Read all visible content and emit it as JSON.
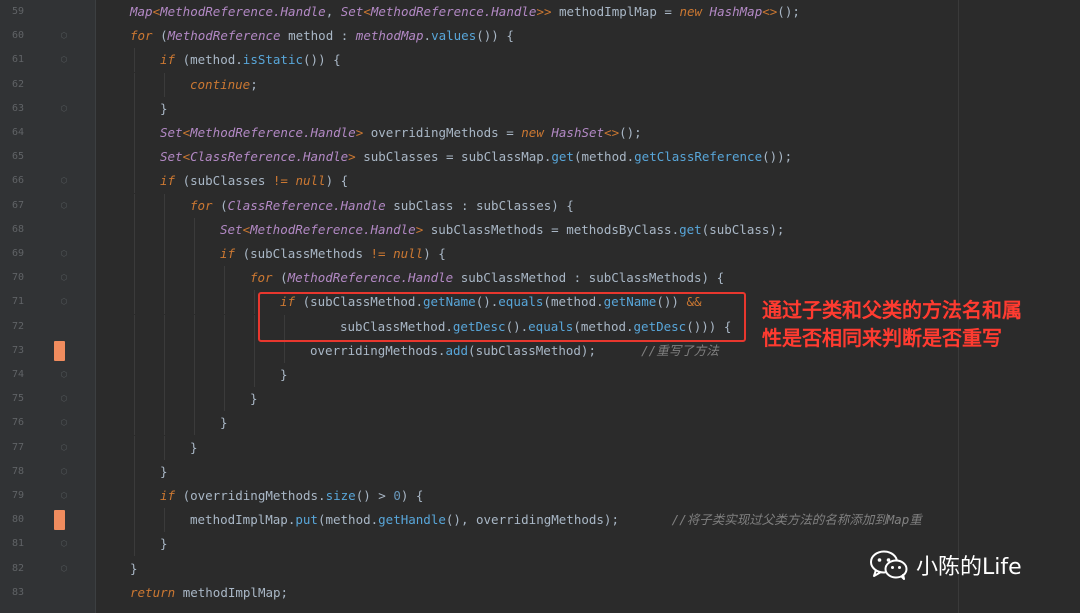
{
  "editor": {
    "lines": [
      {
        "num": "59",
        "indent": 0,
        "tokens": [
          [
            "tp",
            "Map"
          ],
          [
            "gen",
            "<"
          ],
          [
            "tp",
            "MethodReference.Handle"
          ],
          [
            "op",
            ", "
          ],
          [
            "tp",
            "Set"
          ],
          [
            "gen",
            "<"
          ],
          [
            "tp",
            "MethodReference.Handle"
          ],
          [
            "gen",
            ">>"
          ],
          [
            "op",
            " methodImplMap = "
          ],
          [
            "kw",
            "new "
          ],
          [
            "tp",
            "HashMap"
          ],
          [
            "gen",
            "<>"
          ],
          [
            "op",
            "();"
          ]
        ]
      },
      {
        "num": "60",
        "indent": 0,
        "fold": "open",
        "tokens": [
          [
            "kw",
            "for "
          ],
          [
            "op",
            "("
          ],
          [
            "tp",
            "MethodReference "
          ],
          [
            "op",
            "method : "
          ],
          [
            "tp",
            "methodMap"
          ],
          [
            "op",
            "."
          ],
          [
            "meth",
            "values"
          ],
          [
            "op",
            "()) {"
          ]
        ]
      },
      {
        "num": "61",
        "indent": 1,
        "fold": "open",
        "tokens": [
          [
            "kw",
            "if "
          ],
          [
            "op",
            "(method."
          ],
          [
            "meth",
            "isStatic"
          ],
          [
            "op",
            "()) {"
          ]
        ]
      },
      {
        "num": "62",
        "indent": 2,
        "tokens": [
          [
            "kw",
            "continue"
          ],
          [
            "op",
            ";"
          ]
        ]
      },
      {
        "num": "63",
        "indent": 1,
        "fold": "end",
        "tokens": [
          [
            "op",
            "}"
          ]
        ]
      },
      {
        "num": "64",
        "indent": 1,
        "tokens": [
          [
            "tp",
            "Set"
          ],
          [
            "gen",
            "<"
          ],
          [
            "tp",
            "MethodReference.Handle"
          ],
          [
            "gen",
            ">"
          ],
          [
            "op",
            " overridingMethods = "
          ],
          [
            "kw",
            "new "
          ],
          [
            "tp",
            "HashSet"
          ],
          [
            "gen",
            "<>"
          ],
          [
            "op",
            "();"
          ]
        ]
      },
      {
        "num": "65",
        "indent": 1,
        "tokens": [
          [
            "tp",
            "Set"
          ],
          [
            "gen",
            "<"
          ],
          [
            "tp",
            "ClassReference.Handle"
          ],
          [
            "gen",
            ">"
          ],
          [
            "op",
            " subClasses = subClassMap."
          ],
          [
            "meth",
            "get"
          ],
          [
            "op",
            "(method."
          ],
          [
            "meth",
            "getClassReference"
          ],
          [
            "op",
            "());"
          ]
        ]
      },
      {
        "num": "66",
        "indent": 1,
        "fold": "open",
        "tokens": [
          [
            "kw",
            "if "
          ],
          [
            "op",
            "(subClasses "
          ],
          [
            "gen",
            "!= "
          ],
          [
            "kw",
            "null"
          ],
          [
            "op",
            ") {"
          ]
        ]
      },
      {
        "num": "67",
        "indent": 2,
        "fold": "open",
        "tokens": [
          [
            "kw",
            "for "
          ],
          [
            "op",
            "("
          ],
          [
            "tp",
            "ClassReference.Handle "
          ],
          [
            "op",
            "subClass : subClasses) {"
          ]
        ]
      },
      {
        "num": "68",
        "indent": 3,
        "tokens": [
          [
            "tp",
            "Set"
          ],
          [
            "gen",
            "<"
          ],
          [
            "tp",
            "MethodReference.Handle"
          ],
          [
            "gen",
            ">"
          ],
          [
            "op",
            " subClassMethods = methodsByClass."
          ],
          [
            "meth",
            "get"
          ],
          [
            "op",
            "(subClass);"
          ]
        ]
      },
      {
        "num": "69",
        "indent": 3,
        "fold": "open",
        "tokens": [
          [
            "kw",
            "if "
          ],
          [
            "op",
            "(subClassMethods "
          ],
          [
            "gen",
            "!= "
          ],
          [
            "kw",
            "null"
          ],
          [
            "op",
            ") {"
          ]
        ]
      },
      {
        "num": "70",
        "indent": 4,
        "fold": "open",
        "tokens": [
          [
            "kw",
            "for "
          ],
          [
            "op",
            "("
          ],
          [
            "tp",
            "MethodReference.Handle "
          ],
          [
            "op",
            "subClassMethod : subClassMethods) {"
          ]
        ]
      },
      {
        "num": "71",
        "indent": 5,
        "fold": "open",
        "tokens": [
          [
            "kw",
            "if "
          ],
          [
            "op",
            "(subClassMethod."
          ],
          [
            "meth",
            "getName"
          ],
          [
            "op",
            "()."
          ],
          [
            "meth",
            "equals"
          ],
          [
            "op",
            "(method."
          ],
          [
            "meth",
            "getName"
          ],
          [
            "op",
            "()) "
          ],
          [
            "gen",
            "&&"
          ]
        ]
      },
      {
        "num": "72",
        "indent": 7,
        "tokens": [
          [
            "op",
            "subClassMethod."
          ],
          [
            "meth",
            "getDesc"
          ],
          [
            "op",
            "()."
          ],
          [
            "meth",
            "equals"
          ],
          [
            "op",
            "(method."
          ],
          [
            "meth",
            "getDesc"
          ],
          [
            "op",
            "())) {"
          ]
        ]
      },
      {
        "num": "73",
        "indent": 6,
        "marker": true,
        "tokens": [
          [
            "op",
            "overridingMethods."
          ],
          [
            "meth",
            "add"
          ],
          [
            "op",
            "(subClassMethod);      "
          ],
          [
            "cm",
            "//重写了方法"
          ]
        ]
      },
      {
        "num": "74",
        "indent": 5,
        "fold": "end",
        "tokens": [
          [
            "op",
            "}"
          ]
        ]
      },
      {
        "num": "75",
        "indent": 4,
        "fold": "end",
        "tokens": [
          [
            "op",
            "}"
          ]
        ]
      },
      {
        "num": "76",
        "indent": 3,
        "fold": "end",
        "tokens": [
          [
            "op",
            "}"
          ]
        ]
      },
      {
        "num": "77",
        "indent": 2,
        "fold": "end",
        "tokens": [
          [
            "op",
            "}"
          ]
        ]
      },
      {
        "num": "78",
        "indent": 1,
        "fold": "end",
        "tokens": [
          [
            "op",
            "}"
          ]
        ]
      },
      {
        "num": "79",
        "indent": 1,
        "fold": "open",
        "tokens": [
          [
            "kw",
            "if "
          ],
          [
            "op",
            "(overridingMethods."
          ],
          [
            "meth",
            "size"
          ],
          [
            "op",
            "() > "
          ],
          [
            "num",
            "0"
          ],
          [
            "op",
            ") {"
          ]
        ]
      },
      {
        "num": "80",
        "indent": 2,
        "marker": true,
        "tokens": [
          [
            "op",
            "methodImplMap."
          ],
          [
            "meth",
            "put"
          ],
          [
            "op",
            "(method."
          ],
          [
            "meth",
            "getHandle"
          ],
          [
            "op",
            "(), overridingMethods);       "
          ],
          [
            "cm",
            "//将子类实现过父类方法的名称添加到Map重"
          ]
        ]
      },
      {
        "num": "81",
        "indent": 1,
        "fold": "end",
        "tokens": [
          [
            "op",
            "}"
          ]
        ]
      },
      {
        "num": "82",
        "indent": 0,
        "fold": "end",
        "tokens": [
          [
            "op",
            "}"
          ]
        ]
      },
      {
        "num": "83",
        "indent": 0,
        "tokens": [
          [
            "kw",
            "return "
          ],
          [
            "op",
            "methodImplMap;"
          ]
        ]
      }
    ]
  },
  "annotation": {
    "line1": "通过子类和父类的方法名和属",
    "line2": "性是否相同来判断是否重写",
    "color": "#ff3b30"
  },
  "watermark": {
    "icon": "wechat-icon",
    "text": "小陈的Life"
  },
  "colors": {
    "background": "#2b2b2b",
    "gutter": "#313335",
    "keyword": "#cc7832",
    "type": "#b389c5",
    "method": "#58a6d9",
    "comment": "#808080",
    "marker": "#f08c5e"
  }
}
